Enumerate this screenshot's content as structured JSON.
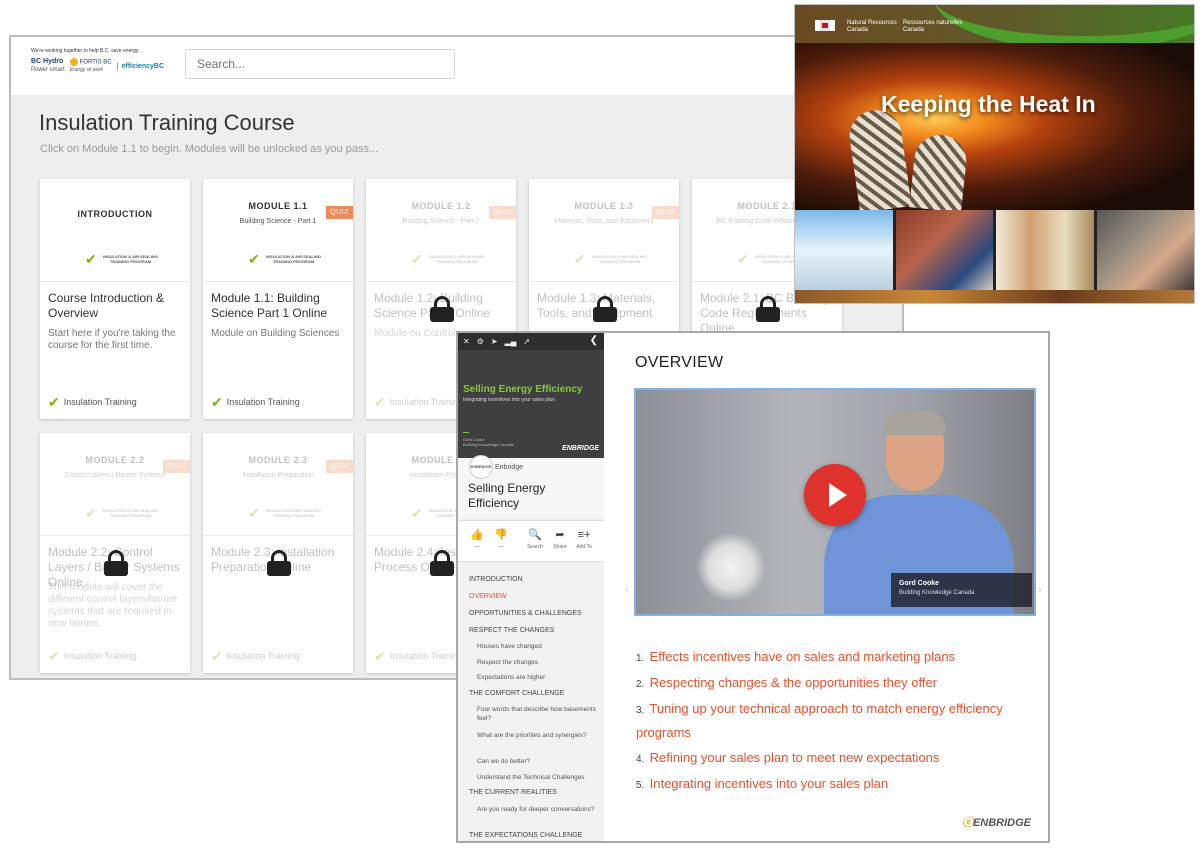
{
  "portal": {
    "tagline": "We're working together to help B.C. save energy.",
    "logo_bchydro": "BC Hydro",
    "logo_bchydro_sub": "Power smart",
    "logo_fortis": "FORTIS BC",
    "logo_fortis_sub": "Energy at work",
    "logo_efficiency": "efficiencyBC",
    "search_placeholder": "Search...",
    "title": "Insulation Training Course",
    "subtitle": "Click on Module 1.1 to begin. Modules will be unlocked as you pass...",
    "program_logo_text": "INSULATION & AIR SEALING TRAINING PROGRAM",
    "cards": [
      {
        "kicker": "INTRODUCTION",
        "sub": "",
        "quiz": "",
        "title": "Course Introduction & Overview",
        "desc": "Start here if you're taking the course for the first time.",
        "footer": "Insulation Training"
      },
      {
        "kicker": "MODULE 1.1",
        "sub": "Building Science - Part 1",
        "quiz": "QUIZ",
        "title": "Module 1.1: Building Science Part 1 Online",
        "desc": "Module on Building Sciences",
        "footer": "Insulation Training"
      },
      {
        "kicker": "MODULE 1.2",
        "sub": "Building Science - Part 2",
        "quiz": "QUIZ",
        "title": "Module 1.2: Building Science Part 2 Online",
        "desc": "Module on Control",
        "footer": "Insulation Training"
      },
      {
        "kicker": "MODULE 1.3",
        "sub": "Materials, Tools, and Equipment",
        "quiz": "QUIZ",
        "title": "Module 1.3: Materials, Tools, and Equipment",
        "desc": "",
        "footer": ""
      },
      {
        "kicker": "MODULE 2.1",
        "sub": "BC Building Code Requirements",
        "quiz": "",
        "title": "Module 2.1: BC Building Code Requirements Online",
        "desc": "",
        "footer": ""
      },
      {
        "kicker": "MODULE 2.2",
        "sub": "Control Layers / Barrier Systems",
        "quiz": "QUIZ",
        "title": "Module 2.2: Control Layers / Barrier Systems Online",
        "desc": "This module will cover the different control layers/barrier systems that are required in new homes.",
        "footer": "Insulation Training"
      },
      {
        "kicker": "MODULE 2.3",
        "sub": "Installation Preparation",
        "quiz": "QUIZ",
        "title": "Module 2.3: Installation Preparation Online",
        "desc": "",
        "footer": "Insulation Training"
      },
      {
        "kicker": "MODULE 2.4",
        "sub": "Installation Process",
        "quiz": "",
        "title": "Module 2.4: Installation Process Online",
        "desc": "",
        "footer": "Insulation Training"
      }
    ]
  },
  "nrcan": {
    "dept_en_1": "Natural Resources",
    "dept_en_2": "Canada",
    "dept_fr_1": "Ressources naturelles",
    "dept_fr_2": "Canada",
    "title": "Keeping the Heat In"
  },
  "course": {
    "hero_title": "Selling Energy Efficiency",
    "hero_sub": "Integrating incentives into your sales plan",
    "hero_presenter_1": "Gord Cooke",
    "hero_presenter_2": "Building Knowledge Canada",
    "hero_logo": "ENBRIDGE",
    "channel_avatar": "ENBRIDGE",
    "channel": "Enbridge",
    "channel_title": "Selling Energy Efficiency",
    "actions": [
      {
        "icon": "👍",
        "label": "—"
      },
      {
        "icon": "👎",
        "label": "—"
      },
      {
        "icon": "🔍",
        "label": "Search"
      },
      {
        "icon": "➦",
        "label": "Share"
      },
      {
        "icon": "≡+",
        "label": "Add To"
      }
    ],
    "toc": [
      {
        "label": "INTRODUCTION",
        "sub": false,
        "active": false
      },
      {
        "label": "OVERVIEW",
        "sub": false,
        "active": true
      },
      {
        "label": "OPPORTUNITIES & CHALLENGES",
        "sub": false,
        "active": false
      },
      {
        "label": "RESPECT THE CHANGES",
        "sub": false,
        "active": false
      },
      {
        "label": "Houses have changed",
        "sub": true,
        "active": false
      },
      {
        "label": "Respect the changes",
        "sub": true,
        "active": false
      },
      {
        "label": "Expectations are higher",
        "sub": true,
        "active": false
      },
      {
        "label": "THE COMFORT CHALLENGE",
        "sub": false,
        "active": false
      },
      {
        "label": "Four words that describe how basements feel?",
        "sub": true,
        "active": false
      },
      {
        "label": "What are the priorities and synergies?",
        "sub": true,
        "active": false
      },
      {
        "label": "Can we do better?",
        "sub": true,
        "active": false
      },
      {
        "label": "Understand the Technical Challenges",
        "sub": true,
        "active": false
      },
      {
        "label": "THE CURRENT REALITIES",
        "sub": false,
        "active": false
      },
      {
        "label": "Are you ready for deeper conversations?",
        "sub": true,
        "active": false
      },
      {
        "label": "THE EXPECTATIONS CHALLENGE",
        "sub": false,
        "active": false
      }
    ],
    "section_title": "OVERVIEW",
    "video_name": "Gord Cooke",
    "video_org": "Building Knowledge Canada",
    "points": [
      {
        "num": "1.",
        "text": "Effects incentives have on sales and marketing plans"
      },
      {
        "num": "2.",
        "text": "Respecting changes & the opportunities they offer"
      },
      {
        "num": "3.",
        "text": "Tuning up your technical approach to match energy efficiency programs"
      },
      {
        "num": "4.",
        "text": "Refining your sales plan to meet new expectations"
      },
      {
        "num": "5.",
        "text": "Integrating incentives into your sales plan"
      }
    ],
    "brand": "ENBRIDGE"
  }
}
